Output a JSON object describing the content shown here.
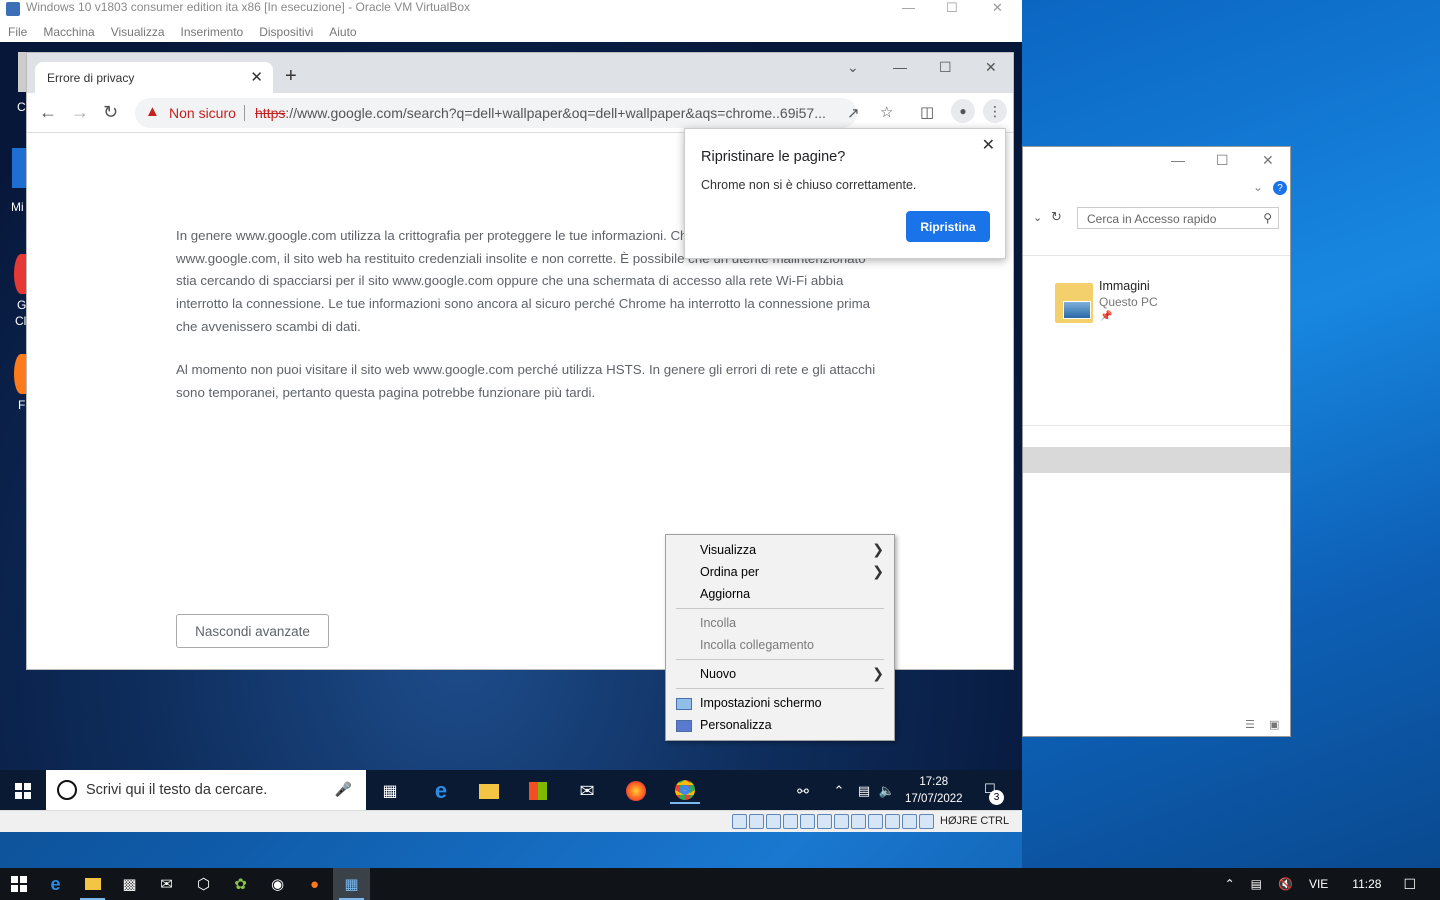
{
  "vbox": {
    "title": "Windows 10 v1803 consumer edition ita x86 [In esecuzione] - Oracle VM VirtualBox",
    "menu": [
      "File",
      "Macchina",
      "Visualizza",
      "Inserimento",
      "Dispositivi",
      "Aiuto"
    ],
    "host_key": "HØJRE CTRL"
  },
  "chrome": {
    "tab_title": "Errore di privacy",
    "security_label": "Non sicuro",
    "url_scheme": "https",
    "url_rest": "://www.google.com/search?q=dell+wallpaper&oq=dell+wallpaper&aqs=chrome..69i57...",
    "paragraph1": "In genere www.google.com utilizza la crittografia per proteggere le tue informazioni. Chrome ha provato a connettersi a www.google.com, il sito web ha restituito credenziali insolite e non corrette. È possibile che un utente malintenzionato stia cercando di spacciarsi per il sito www.google.com oppure che una schermata di accesso alla rete Wi-Fi abbia interrotto la connessione. Le tue informazioni sono ancora al sicuro perché Chrome ha interrotto la connessione prima che avvenissero scambi di dati.",
    "paragraph2": "Al momento non puoi visitare il sito web www.google.com perché utilizza HSTS. In genere gli errori di rete e gli attacchi sono temporanei, pertanto questa pagina potrebbe funzionare più tardi.",
    "hide_button": "Nascondi avanzate"
  },
  "restore_popup": {
    "title": "Ripristinare le pagine?",
    "message": "Chrome non si è chiuso correttamente.",
    "button": "Ripristina"
  },
  "explorer": {
    "search_placeholder": "Cerca in Accesso rapido",
    "folder_name": "Immagini",
    "folder_location": "Questo PC"
  },
  "context_menu": {
    "items": [
      {
        "label": "Visualizza",
        "submenu": true,
        "disabled": false
      },
      {
        "label": "Ordina per",
        "submenu": true,
        "disabled": false
      },
      {
        "label": "Aggiorna",
        "submenu": false,
        "disabled": false
      },
      {
        "label": "Incolla",
        "submenu": false,
        "disabled": true
      },
      {
        "label": "Incolla collegamento",
        "submenu": false,
        "disabled": true
      },
      {
        "label": "Nuovo",
        "submenu": true,
        "disabled": false
      },
      {
        "label": "Impostazioni schermo",
        "submenu": false,
        "disabled": false
      },
      {
        "label": "Personalizza",
        "submenu": false,
        "disabled": false
      }
    ]
  },
  "guest_taskbar": {
    "search_placeholder": "Scrivi qui il testo da cercare.",
    "time": "17:28",
    "date": "17/07/2022",
    "notifications": "3"
  },
  "host_taskbar": {
    "language": "VIE",
    "time": "11:28"
  },
  "desktop_icon_labels": [
    "C",
    "Mi",
    "G",
    "Cl",
    "F"
  ],
  "colors": {
    "accent_blue": "#1a73e8",
    "warning_red": "#c5221f"
  }
}
